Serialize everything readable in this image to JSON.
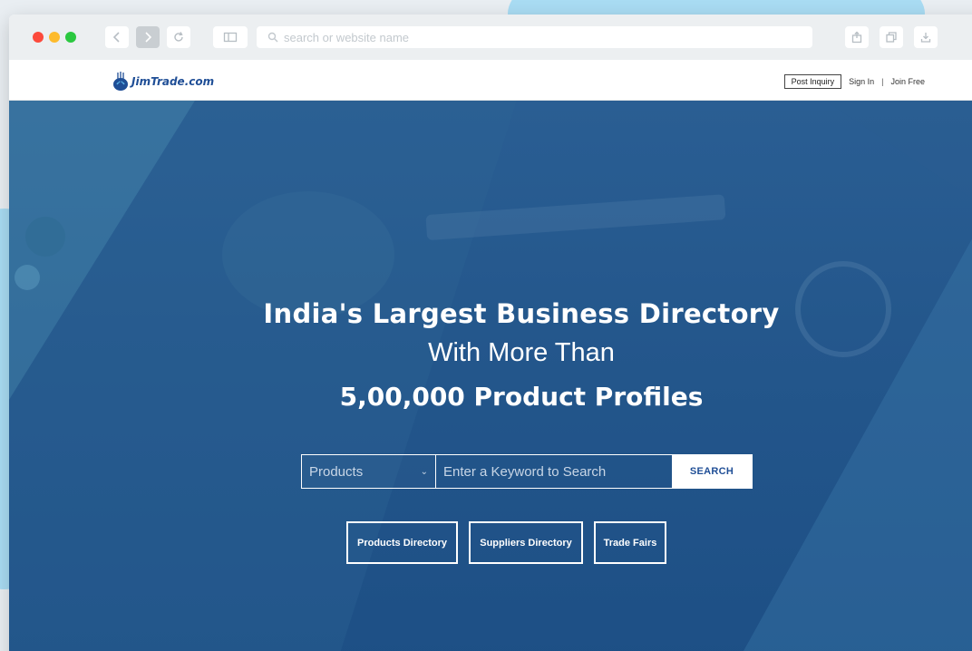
{
  "browser": {
    "address_placeholder": "search or website name",
    "icons": [
      "back-icon",
      "forward-icon",
      "reload-icon",
      "sidebar-icon",
      "search-icon",
      "share-icon",
      "tabs-icon",
      "download-icon"
    ]
  },
  "site": {
    "logo_text": "JimTrade.com",
    "nav": {
      "post_inquiry": "Post Inquiry",
      "sign_in": "Sign In",
      "separator": "|",
      "join_free": "Join Free"
    }
  },
  "hero": {
    "line1": "India's Largest Business Directory",
    "line2": "With More Than",
    "line3": "5,00,000 Product Profiles",
    "search": {
      "category_selected": "Products",
      "keyword_placeholder": "Enter a Keyword to Search",
      "button_label": "SEARCH"
    },
    "directories": [
      {
        "label": "Products Directory"
      },
      {
        "label": "Suppliers Directory"
      },
      {
        "label": "Trade Fairs"
      }
    ]
  },
  "colors": {
    "hero_blue": "#24578c",
    "brand_blue": "#1f4e96",
    "accent_light_blue": "#a9dcf3"
  }
}
